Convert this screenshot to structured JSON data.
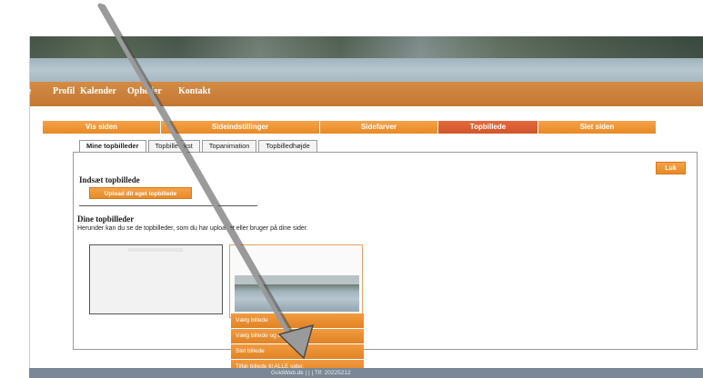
{
  "nav": {
    "items": [
      "Forside",
      "Profil",
      "Kalender",
      "Opheder",
      "Kontakt"
    ]
  },
  "main_tabs": [
    {
      "label": "Vis siden"
    },
    {
      "label": "Sideindstillinger"
    },
    {
      "label": "Sidefarver"
    },
    {
      "label": "Topbillede",
      "active": true
    },
    {
      "label": "Slet siden"
    }
  ],
  "sub_tabs": [
    "Mine topbilleder",
    "Topbilletekst",
    "Topanimation",
    "Topbilledhøjde"
  ],
  "close_label": "Luk",
  "insert": {
    "heading": "Indsæt topbillede",
    "upload_label": "Upload dit eget topbillede"
  },
  "mine": {
    "heading": "Dine topbilleder",
    "description": "Herunder kan du se de topbilleder, som du har uploadet eller bruger på dine sider."
  },
  "context_menu": [
    "Vælg billede",
    "Vælg billede og tilpas højde",
    "Slet billede",
    "Tilføj billede til ALLE sider."
  ],
  "footer": {
    "text": "GoldWeb.dk | | | Tlf: 20225212"
  },
  "colors": {
    "orange": "#e88a25",
    "active_tab": "#d2552a",
    "nav": "#c47632",
    "footer": "#7a8796"
  }
}
